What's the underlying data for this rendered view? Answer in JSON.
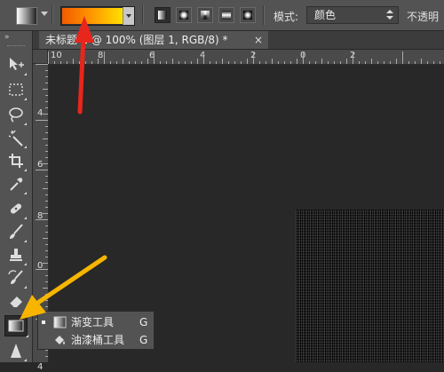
{
  "options_bar": {
    "tool_preset_icon": "gradient-tool-preset-icon",
    "gradient_colors": [
      "#f25b00",
      "#ff9900",
      "#ffe000"
    ],
    "gradient_types": [
      "linear",
      "radial",
      "angle",
      "reflected",
      "diamond"
    ],
    "selected_gradient_type": "linear",
    "mode_label": "模式:",
    "mode_value": "颜色",
    "opacity_label": "不透明"
  },
  "document": {
    "tab_title": "未标题-1 @ 100% (图层 1, RGB/8) *",
    "close_symbol": "×"
  },
  "rulers": {
    "horizontal_labels": [
      "10",
      "8",
      "6",
      "4",
      "2",
      "0",
      "2"
    ],
    "vertical_labels": [
      "4",
      "6",
      "8",
      "0",
      "2",
      "4"
    ]
  },
  "toolbar": {
    "collapse_symbol": "»",
    "tools": [
      "move-tool",
      "marquee-tool",
      "lasso-tool",
      "magic-wand-tool",
      "crop-tool",
      "eyedropper-tool",
      "healing-brush-tool",
      "brush-tool",
      "clone-stamp-tool",
      "history-brush-tool",
      "eraser-tool",
      "gradient-tool",
      "sharpen-tool"
    ],
    "active_tool": "gradient-tool"
  },
  "flyout": {
    "items": [
      {
        "label": "渐变工具",
        "shortcut": "G",
        "icon": "gradient-icon",
        "selected": true
      },
      {
        "label": "油漆桶工具",
        "shortcut": "G",
        "icon": "paint-bucket-icon",
        "selected": false
      }
    ]
  },
  "colors": {
    "annotation_red": "#e8261c",
    "annotation_yellow": "#f7b500",
    "ui_panel": "#535353",
    "canvas_bg": "#282828"
  }
}
